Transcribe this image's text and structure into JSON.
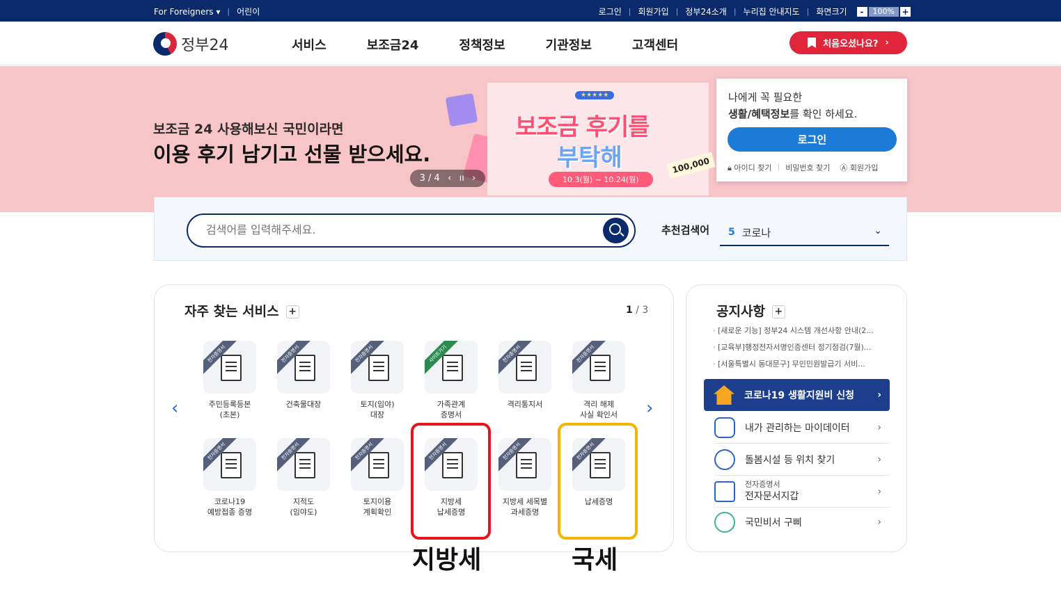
{
  "topbar": {
    "foreigners": "For Foreigners ▾",
    "kids": "어린이",
    "login": "로그인",
    "signup": "회원가입",
    "about": "정부24소개",
    "sitemap": "누리집 안내지도",
    "screen_size": "화면크기",
    "zoom": "100%",
    "minus": "-",
    "plus": "+"
  },
  "nav": {
    "logo_text": "정부24",
    "menu": [
      "서비스",
      "보조금24",
      "정책정보",
      "기관정보",
      "고객센터"
    ],
    "cta": "처음오셨나요?",
    "cta_arrow": "›"
  },
  "hero": {
    "line1": "보조금 24 사용해보신 국민이라면",
    "line2": "이용 후기 남기고 선물 받으세요.",
    "banner_title1": "보조금 후기를",
    "banner_title2": "부탁해",
    "banner_stars": "★★★★★",
    "banner_date": "10.3(월) ~ 10.24(월)",
    "banner_amount": "100,000",
    "pager": "3 / 4",
    "pager_prev": "‹",
    "pager_pause": "ıı",
    "pager_next": "›"
  },
  "login_box": {
    "msg1": "나에게 꼭 필요한",
    "msg2_bold": "생활/혜택정보",
    "msg2_rest": "를 확인 하세요.",
    "button": "로그인",
    "find_id": "아이디 찾기",
    "find_pw": "비밀번호 찾기",
    "join": "회원가입"
  },
  "search": {
    "placeholder": "검색어를 입력해주세요.",
    "rec_label": "추천검색어",
    "rec_num": "5",
    "rec_value": "코로나",
    "rec_chevron": "⌄"
  },
  "frequent": {
    "title": "자주 찾는 서비스",
    "plus": "+",
    "page_current": "1",
    "page_total": "/ 3",
    "prev": "‹",
    "next": "›",
    "items": [
      {
        "tag": "전자증명서",
        "label": "주민등록등본\n(초본)"
      },
      {
        "tag": "전자증명서",
        "label": "건축물대장"
      },
      {
        "tag": "전자증명서",
        "label": "토지(임야)\n대장"
      },
      {
        "tag": "사이트가기",
        "label": "가족관계\n증명서"
      },
      {
        "tag": "전자증명서",
        "label": "격리통지서"
      },
      {
        "tag": "전자증명서",
        "label": "격리 해제\n사실 확인서"
      },
      {
        "tag": "전자증명서",
        "label": "코로나19\n예방접종 증명"
      },
      {
        "tag": "전자증명서",
        "label": "지적도\n(임야도)"
      },
      {
        "tag": "전자증명서",
        "label": "토지이용\n계획확인"
      },
      {
        "tag": "전자증명서",
        "label": "지방세\n납세증명"
      },
      {
        "tag": "전자증명서",
        "label": "지방세 세목별\n과세증명"
      },
      {
        "tag": "전자증명서",
        "label": "납세증명"
      }
    ]
  },
  "annotations": {
    "local_tax": "지방세",
    "national_tax": "국세",
    "red": "#e8141c",
    "yellow": "#f5b400"
  },
  "notice": {
    "title": "공지사항",
    "plus": "+",
    "items": [
      "[새로운 기능] 정부24 시스템 개선사항 안내(2...",
      "[교육부]행정전자서명인증센터 정기점검(7월)...",
      "[서울특별시 동대문구] 무인민원발급기 서비..."
    ],
    "quick": [
      {
        "label": "코로나19 생활지원비 신청",
        "icon": "house-icon"
      },
      {
        "label": "내가 관리하는 마이데이터",
        "icon": "cloud-db-icon"
      },
      {
        "label": "돌봄시설 등 위치 찾기",
        "icon": "location-pin-icon"
      },
      {
        "label_small": "전자증명서",
        "label": "전자문서지갑",
        "icon": "wallet-icon"
      },
      {
        "label": "국민비서 구삐",
        "icon": "bird-mascot-icon"
      }
    ],
    "arrow": "›"
  },
  "colors": {
    "navy": "#0b2a6b",
    "hero_pink": "#f7c4c8",
    "cta_red": "#e0243a",
    "login_blue": "#1c7bd4"
  }
}
